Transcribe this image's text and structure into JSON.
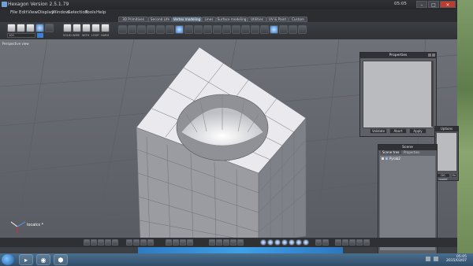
{
  "window": {
    "title": "Hexagon Version 2.5.1.79",
    "clock": "05:05",
    "min": "–",
    "max": "□",
    "close": "✕"
  },
  "menu": [
    "File",
    "Edit",
    "View",
    "Display",
    "Window",
    "Selection",
    "Tools",
    "Help"
  ],
  "tabs": [
    {
      "label": "3D Primitives",
      "active": false
    },
    {
      "label": "Second Life",
      "active": false
    },
    {
      "label": "Vertex modeling",
      "active": true
    },
    {
      "label": "Lines",
      "active": false
    },
    {
      "label": "Surface modeling",
      "active": false
    },
    {
      "label": "Utilities",
      "active": false
    },
    {
      "label": "UV & Paint",
      "active": false
    },
    {
      "label": "Custom",
      "active": false
    }
  ],
  "toolbar": {
    "labels": [
      "SOLID",
      "WIRE",
      "WITH",
      "LOOP",
      "HARD"
    ],
    "value_field": "100"
  },
  "viewport": {
    "label": "Perspective view",
    "local_cs": "localcs *"
  },
  "properties": {
    "title": "Properties",
    "buttons": [
      "Validate",
      "Abort",
      "Apply"
    ]
  },
  "scene": {
    "title": "Scene",
    "tabs": [
      "Scene tree",
      "Properties"
    ],
    "items": [
      "Pyrab2"
    ]
  },
  "uv": {
    "title": "Uptions",
    "buttons": [
      "DG model",
      "Ex"
    ]
  },
  "tray": {
    "time": "05:05",
    "date": "2015/03/07"
  }
}
